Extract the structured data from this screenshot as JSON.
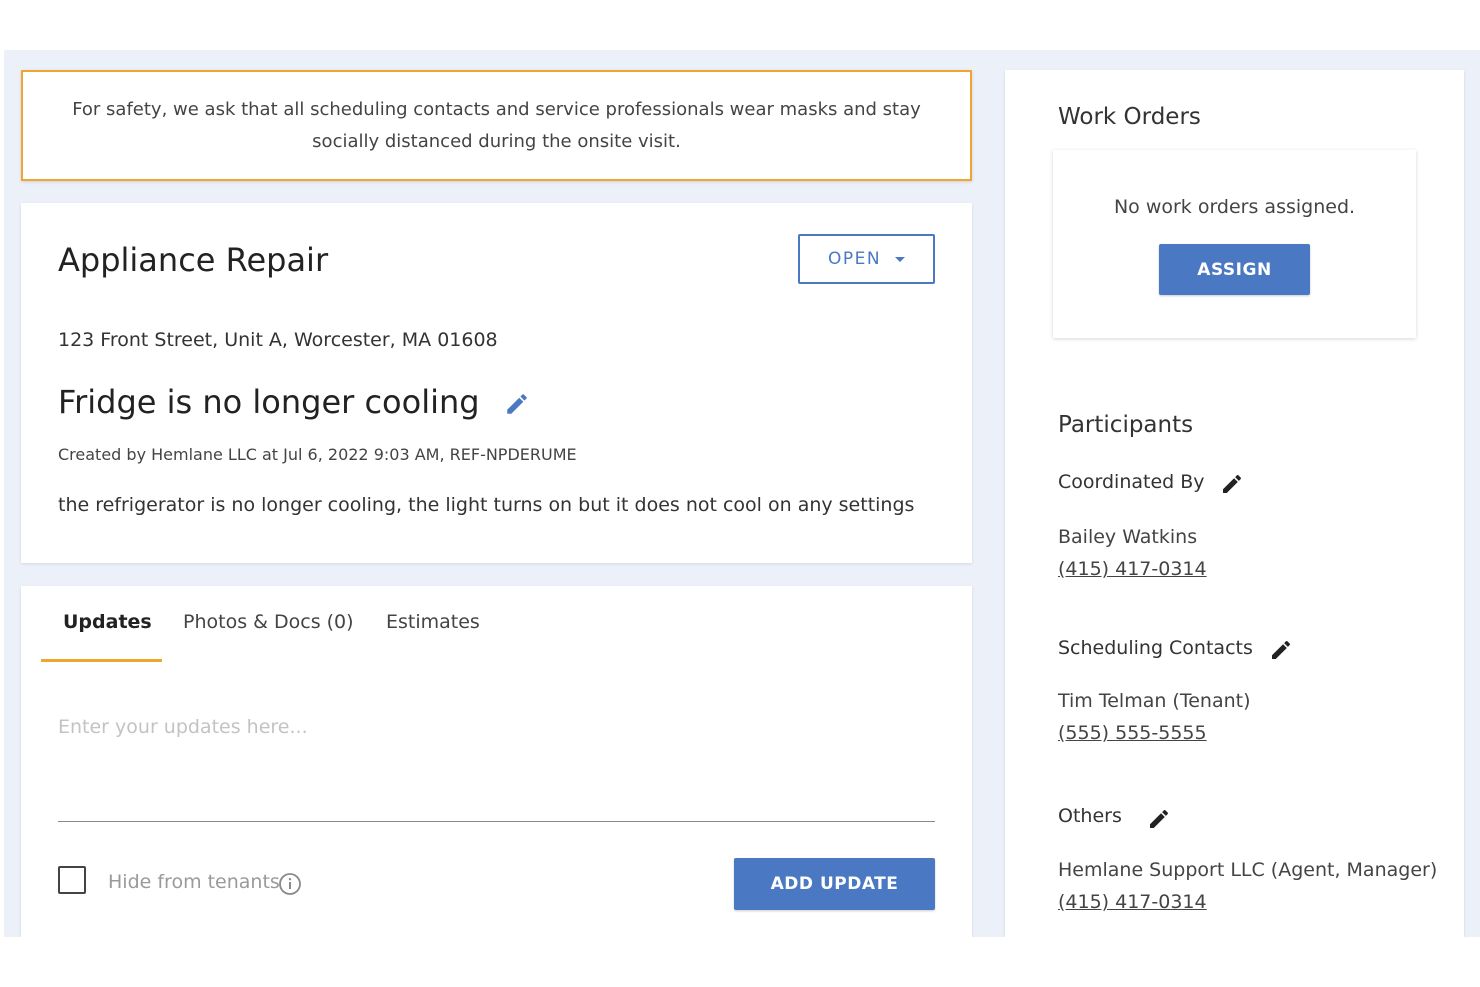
{
  "banner": {
    "text": "For safety, we ask that all scheduling contacts and service professionals wear masks and stay socially distanced during the onsite visit."
  },
  "request": {
    "category": "Appliance Repair",
    "status": "OPEN",
    "address": "123 Front Street, Unit A, Worcester, MA 01608",
    "title": "Fridge is no longer cooling",
    "meta": "Created by Hemlane LLC at Jul 6, 2022 9:03 AM, REF-NPDERUME",
    "description": "the refrigerator is no longer cooling, the light turns on but it does not cool on any settings"
  },
  "updates": {
    "tabs": [
      "Updates",
      "Photos & Docs (0)",
      "Estimates"
    ],
    "active_tab": "Updates",
    "placeholder": "Enter your updates here...",
    "hide_label": "Hide from tenants",
    "hide_checked": false,
    "add_label": "ADD UPDATE"
  },
  "work_orders": {
    "title": "Work Orders",
    "empty_text": "No work orders assigned.",
    "assign_label": "ASSIGN"
  },
  "participants": {
    "title": "Participants",
    "coordinated": {
      "label": "Coordinated By",
      "name": "Bailey Watkins",
      "phone": "(415) 417-0314"
    },
    "scheduling": {
      "label": "Scheduling Contacts",
      "name": "Tim Telman (Tenant)",
      "phone": "(555) 555-5555"
    },
    "others": {
      "label": "Others",
      "name": "Hemlane Support LLC (Agent, Manager)",
      "phone": "(415) 417-0314"
    }
  },
  "colors": {
    "accent": "#f0a530",
    "primary": "#4a78c2",
    "background": "#ecf0f8"
  },
  "icons": [
    "pencil-icon",
    "caret-down-icon",
    "info-icon",
    "checkbox-icon"
  ]
}
